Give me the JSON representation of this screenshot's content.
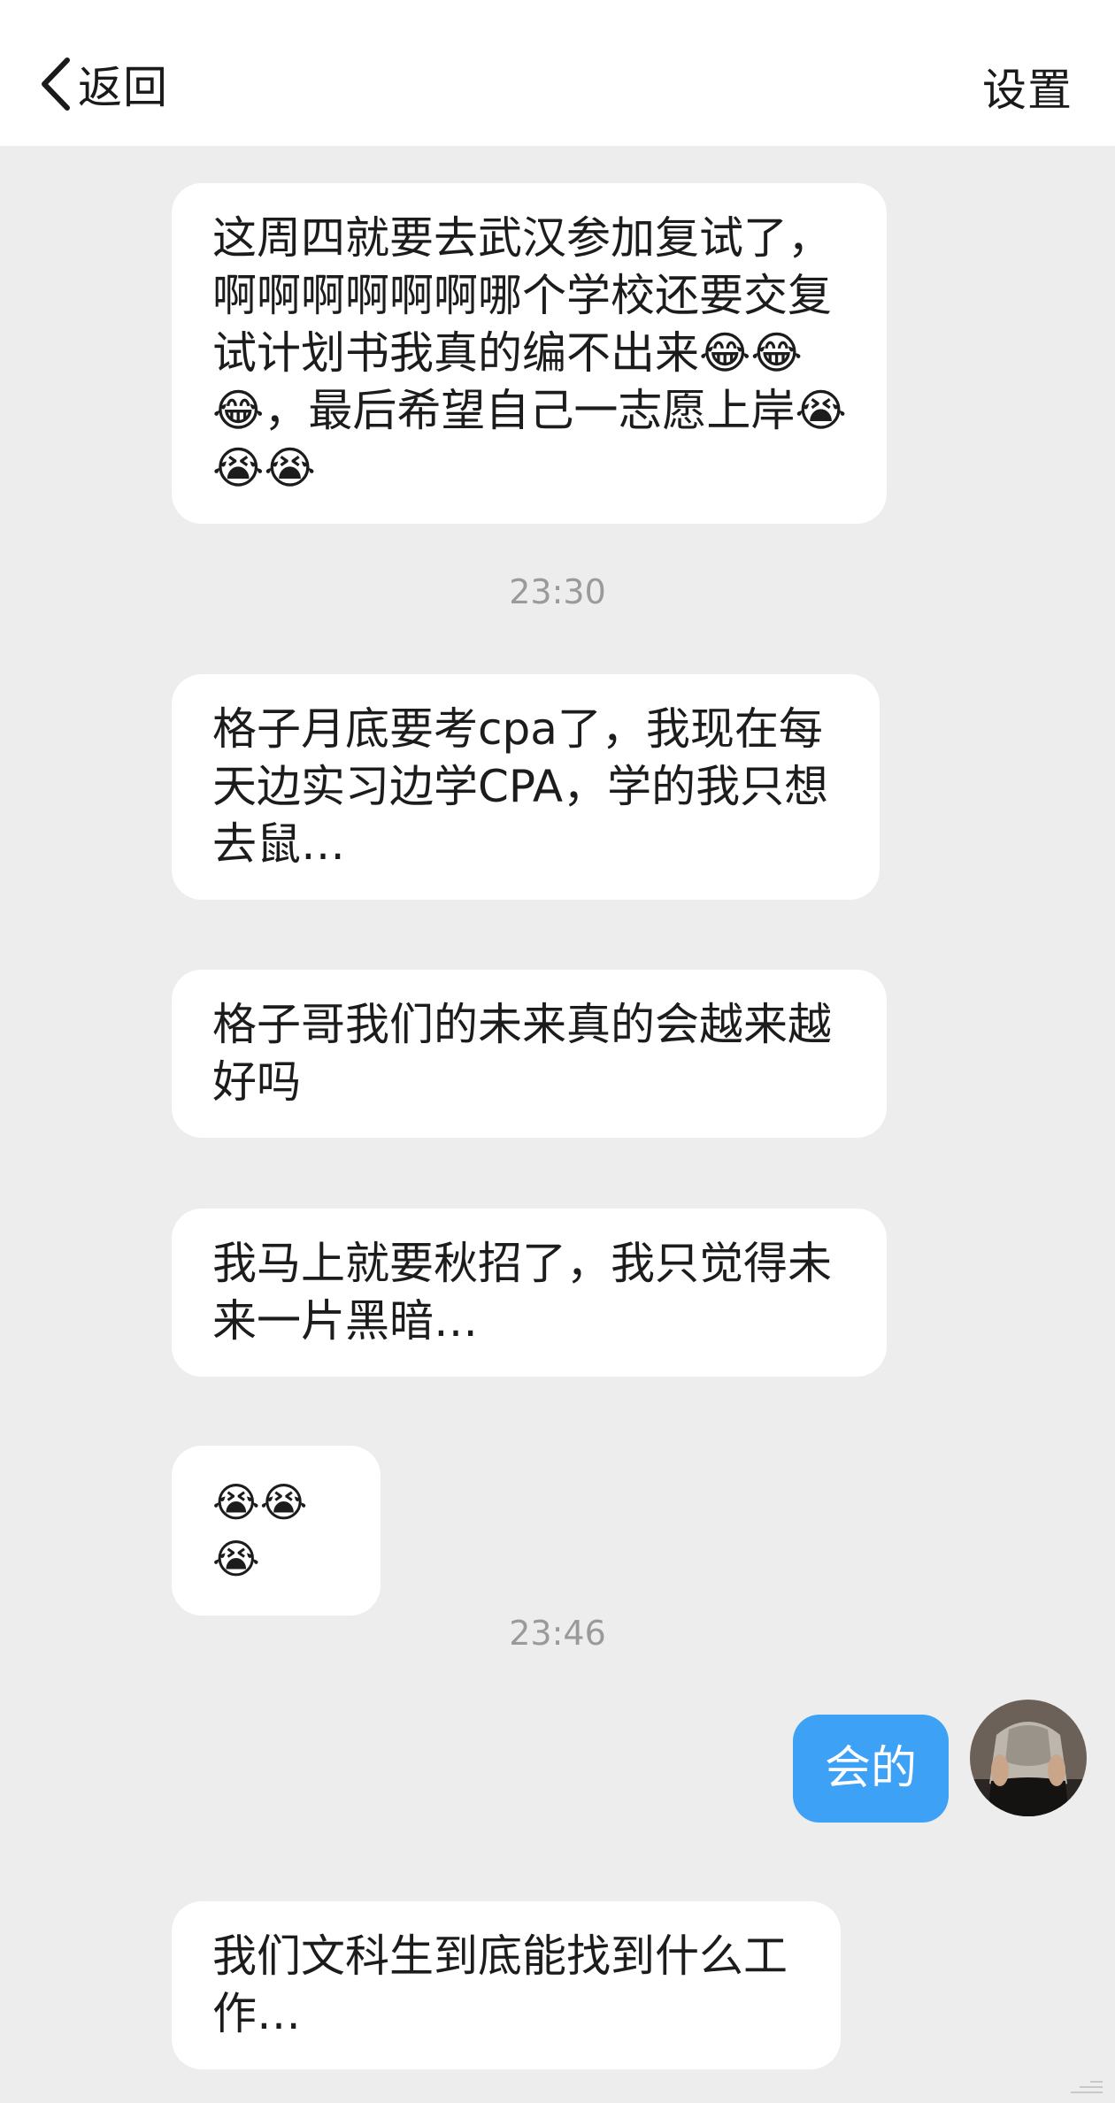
{
  "nav": {
    "back_label": "返回",
    "settings_label": "设置"
  },
  "messages": [
    {
      "text": "这周四就要去武汉参加复试了，啊啊啊啊啊啊哪个学校还要交复试计划书我真的编不出来😂😂😂，最后希望自己一志愿上岸😭😭😭"
    },
    {
      "text": "格子月底要考cpa了，我现在每天边实习边学CPA，学的我只想去鼠…"
    },
    {
      "text": "格子哥我们的未来真的会越来越好吗"
    },
    {
      "text": "我马上就要秋招了，我只觉得未来一片黑暗…"
    },
    {
      "text": "😭😭😭"
    },
    {
      "text": "我们文科生到底能找到什么工作…"
    }
  ],
  "timestamps": [
    "23:30",
    "23:46"
  ],
  "reply": {
    "text": "会的"
  },
  "icons": {
    "back": "chevron-left-icon",
    "avatar": "user-avatar",
    "grip": "resize-grip-icon"
  },
  "colors": {
    "background": "#ededed",
    "bubble_in": "#ffffff",
    "bubble_out": "#3da1f5",
    "timestamp": "#9a9a9a"
  }
}
